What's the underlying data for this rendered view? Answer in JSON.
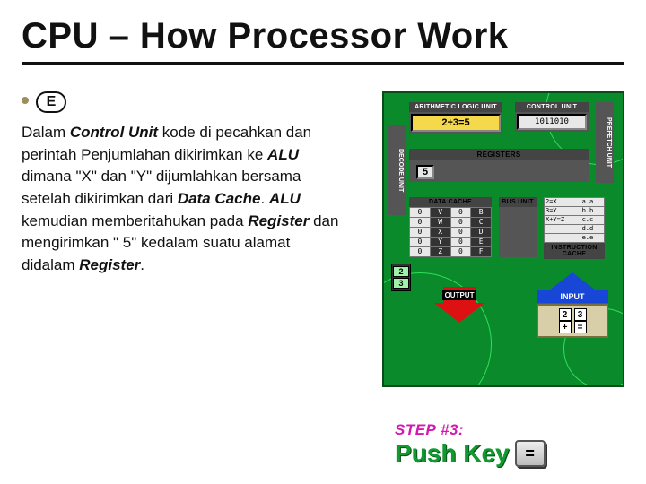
{
  "title": "CPU – How Processor Work",
  "badge_letter": "E",
  "body": {
    "seg1": "Dalam ",
    "b1": "Control Unit",
    "seg2": " kode di pecahkan dan perintah Penjumlahan dikirimkan ke ",
    "b2": "ALU",
    "seg3": " dimana \"X\" dan \"Y\" dijumlahkan bersama setelah dikirimkan dari ",
    "b3": "Data Cache",
    "seg4": ". ",
    "b4": "ALU",
    "seg5": " kemudian memberitahukan pada ",
    "b5": "Register",
    "seg6": " dan mengirimkan \" 5\" kedalam suatu alamat didalam ",
    "b6": "Register",
    "seg7": "."
  },
  "diagram": {
    "alu_label": "ARITHMETIC LOGIC UNIT",
    "alu_value": "2+3=5",
    "ctrl_label": "CONTROL UNIT",
    "ctrl_value": "1011010",
    "decode_label": "DECODE UNIT",
    "prefetch_label": "PREFETCH UNIT",
    "registers_label": "REGISTERS",
    "registers_value": "5",
    "datacache_label": "DATA CACHE",
    "datacache_rows": [
      [
        "0",
        "V",
        "0",
        "B"
      ],
      [
        "0",
        "W",
        "0",
        "C"
      ],
      [
        "0",
        "X",
        "0",
        "D"
      ],
      [
        "0",
        "Y",
        "0",
        "E"
      ],
      [
        "0",
        "Z",
        "0",
        "F"
      ]
    ],
    "bus_label": "BUS UNIT",
    "instr_label": "INSTRUCTION CACHE",
    "instr_rows": [
      [
        "2=X",
        "a.a"
      ],
      [
        "3=Y",
        "b.b"
      ],
      [
        "X+Y=Z",
        "c.c"
      ],
      [
        "",
        "d.d"
      ],
      [
        "",
        "e.e"
      ]
    ],
    "circ": [
      "2",
      "3"
    ],
    "output_label": "OUTPUT",
    "input_label": "INPUT",
    "calc_r1": [
      "2",
      "3"
    ],
    "calc_r2": [
      "+",
      "="
    ]
  },
  "step": {
    "line1": "STEP #3:",
    "line2": "Push Key",
    "key": "="
  }
}
